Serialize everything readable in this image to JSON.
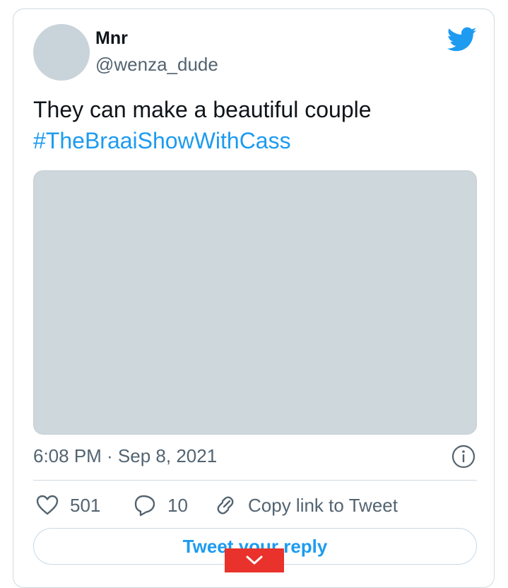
{
  "tweet": {
    "display_name": "Mnr",
    "handle": "@wenza_dude",
    "text": "They can make a beautiful couple",
    "hashtag": "#TheBraaiShowWithCass",
    "timestamp": "6:08 PM · Sep 8, 2021"
  },
  "actions": {
    "like_count": "501",
    "reply_count": "10",
    "copy_link_label": "Copy link to Tweet"
  },
  "reply_button_label": "Tweet your reply",
  "icons": {
    "brand": "twitter-bird-icon",
    "info": "info-icon",
    "like": "heart-icon",
    "reply": "speech-bubble-icon",
    "copy": "link-icon",
    "overlay": "chevron-down-icon"
  },
  "colors": {
    "accent": "#1d9bf0",
    "text": "#0f1419",
    "secondary": "#536471",
    "overlay": "#e8322b"
  }
}
